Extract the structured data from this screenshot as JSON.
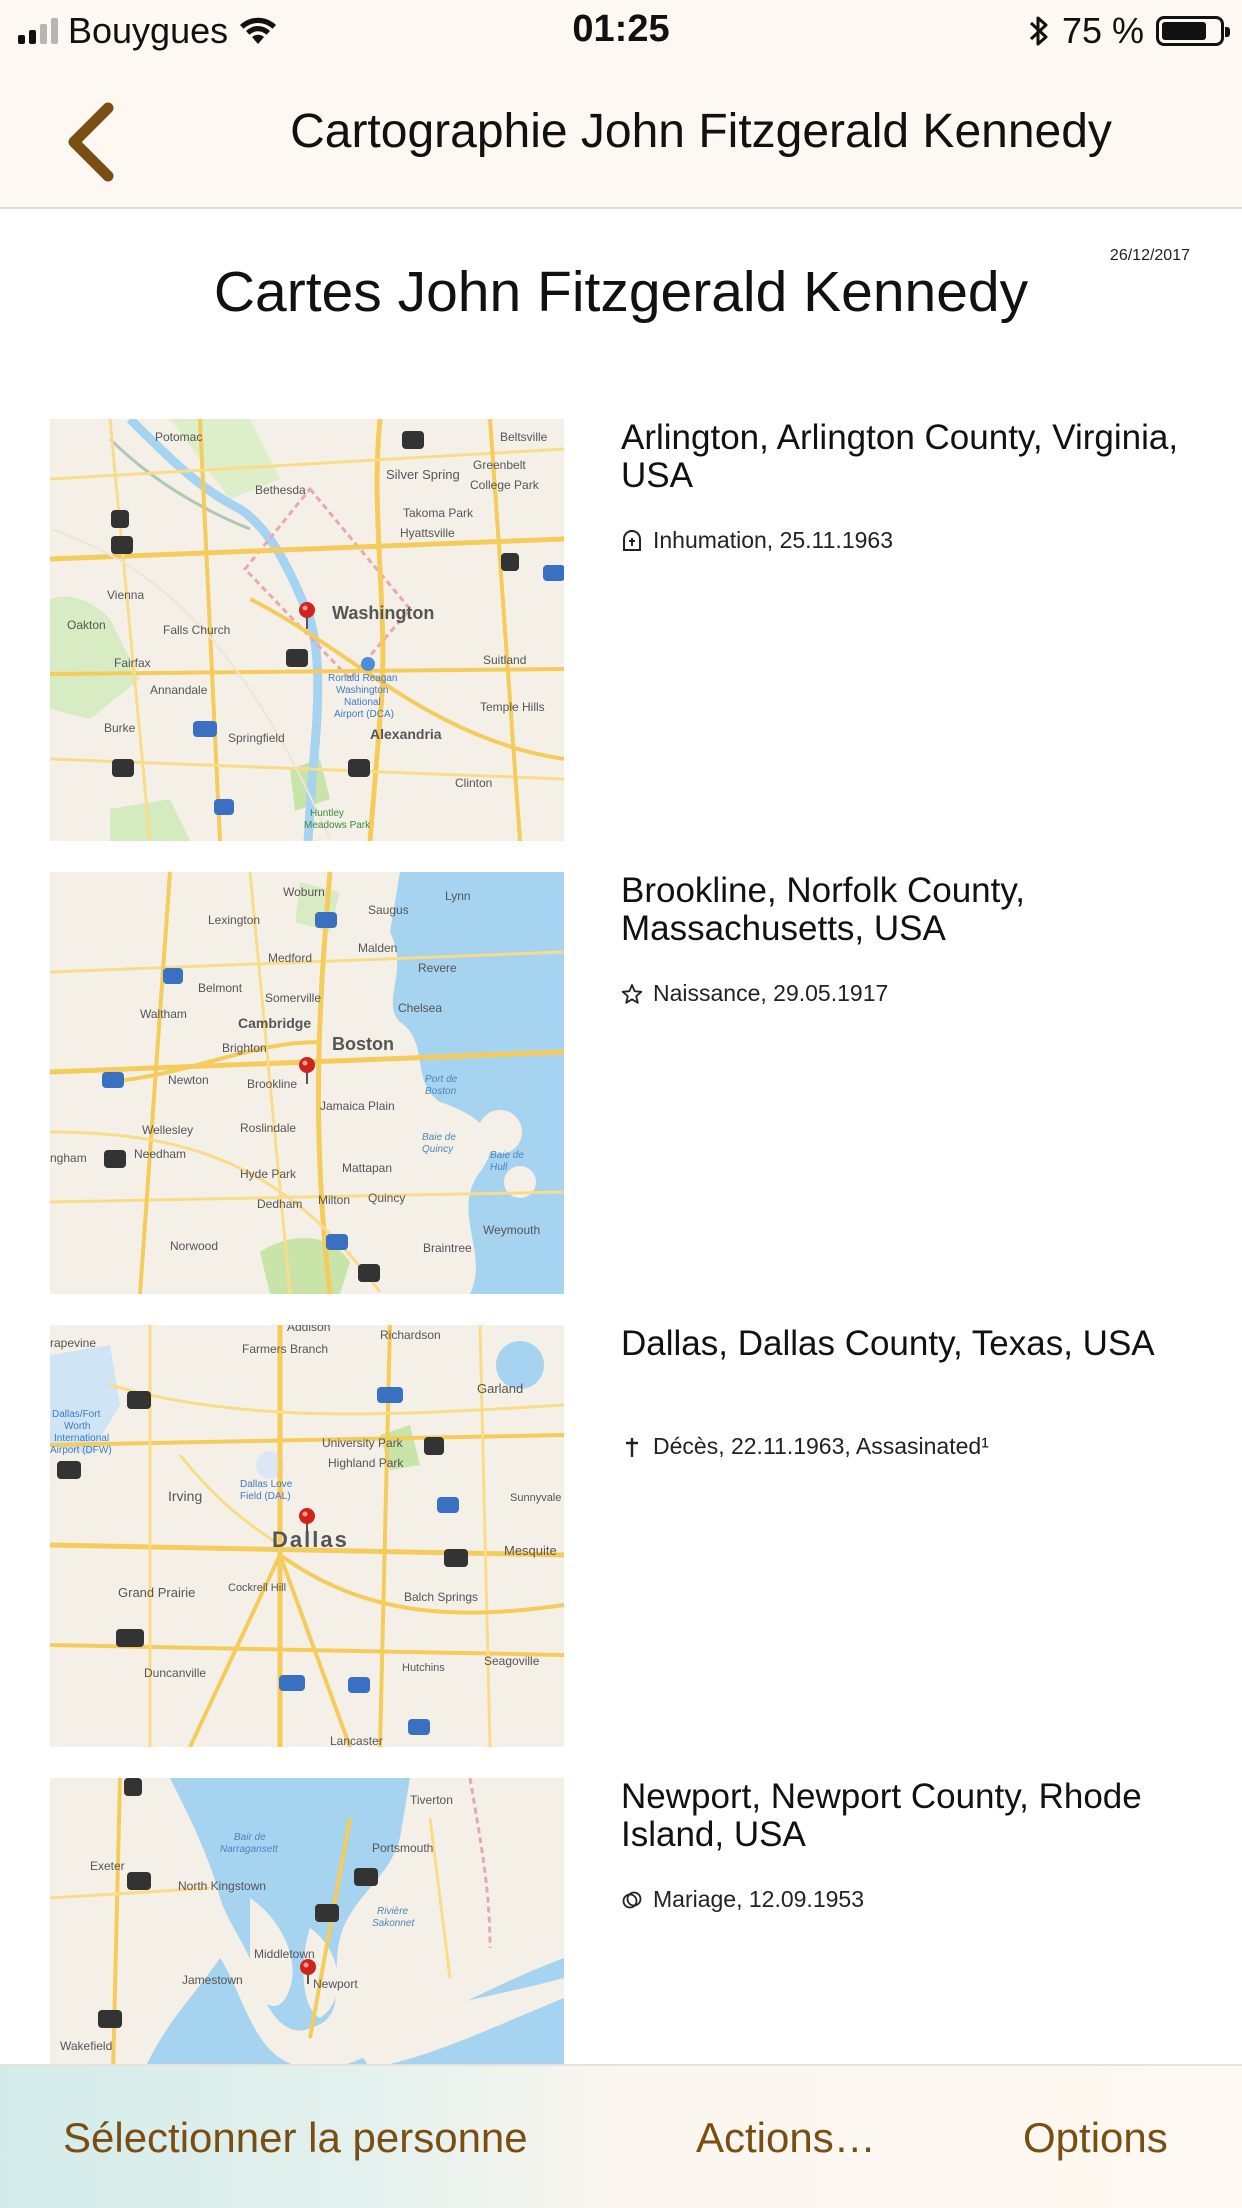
{
  "status_bar": {
    "carrier": "Bouygues",
    "time": "01:25",
    "battery": "75 %"
  },
  "nav": {
    "title": "Cartographie John Fitzgerald Kennedy"
  },
  "page": {
    "date": "26/12/2017",
    "title": "Cartes John Fitzgerald Kennedy"
  },
  "entries": [
    {
      "place": "Arlington, Arlington County, Virginia, USA",
      "event_icon": "tombstone-icon",
      "event": "Inhumation, 25.11.1963",
      "map_labels": [
        "Potomac",
        "Bethesda",
        "Silver Spring",
        "Takoma Park",
        "Hyattsville",
        "Washington",
        "Falls Church",
        "Vienna",
        "Oakton",
        "Fairfax",
        "Annandale",
        "Burke",
        "Springfield",
        "Alexandria",
        "Suitland",
        "Clinton",
        "Huntley Meadows Park",
        "Ronald Reagan Washington National Airport (DCA)",
        "Greenbelt",
        "College Park",
        "Beltsville",
        "Temple Hills"
      ]
    },
    {
      "place": "Brookline, Norfolk County, Massachusetts, USA",
      "event_icon": "star-icon",
      "event": "Naissance, 29.05.1917",
      "map_labels": [
        "Woburn",
        "Lexington",
        "Saugus",
        "Lynn",
        "Malden",
        "Medford",
        "Revere",
        "Belmont",
        "Somerville",
        "Chelsea",
        "Waltham",
        "Cambridge",
        "Brighton",
        "Boston",
        "Newton",
        "Brookline",
        "Wellesley",
        "Roslindale",
        "Jamaica Plain",
        "Needham",
        "Hyde Park",
        "Mattapan",
        "Dedham",
        "Milton",
        "Quincy",
        "Norwood",
        "Braintree",
        "Weymouth",
        "Port de Boston",
        "Baie de Quincy",
        "Baie de Hull"
      ]
    },
    {
      "place": "Dallas, Dallas County, Texas, USA",
      "event_icon": "cross-icon",
      "event": "Décès, 22.11.1963, Assasinated¹",
      "map_labels": [
        "Addison",
        "Richardson",
        "Farmers Branch",
        "Garland",
        "Dallas/Fort Worth International Airport (DFW)",
        "University Park",
        "Highland Park",
        "Irving",
        "Dallas Love Field (DAL)",
        "Dallas",
        "Sunnyvale",
        "Mesquite",
        "Grand Prairie",
        "Cockrell Hill",
        "Balch Springs",
        "Duncanville",
        "Hutchins",
        "Seagoville",
        "Lancaster"
      ]
    },
    {
      "place": "Newport, Newport County, Rhode Island, USA",
      "event_icon": "rings-icon",
      "event": "Mariage, 12.09.1953",
      "map_labels": [
        "Tiverton",
        "Bair de Narragansett",
        "Portsmouth",
        "Exeter",
        "North Kingstown",
        "Rivière Sakonnet",
        "Middletown",
        "Jamestown",
        "Newport",
        "Wakefield"
      ]
    }
  ],
  "toolbar": {
    "select_person": "Sélectionner la personne",
    "actions": "Actions…",
    "options": "Options"
  },
  "colors": {
    "accent": "#7a4e12",
    "bar_bg": "#fdf8f1",
    "pin": "#d0231b",
    "water": "#a6d3f0",
    "road": "#f5cb5b",
    "park": "#c6e3a7"
  }
}
